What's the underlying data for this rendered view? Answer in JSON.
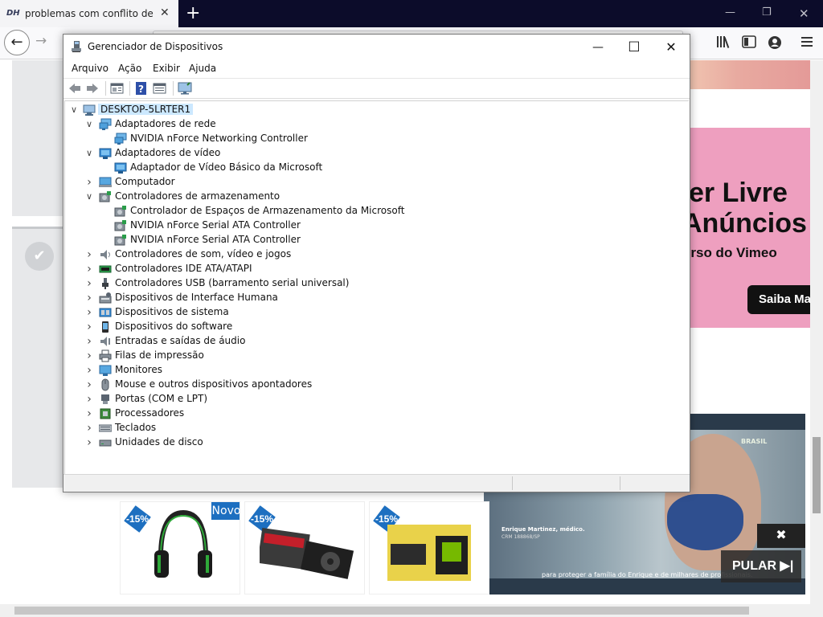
{
  "browser": {
    "tab_title": "problemas com conflito de driv",
    "favicon_text": "DH",
    "newtab_glyph": "+",
    "back_glyph": "←",
    "forward_glyph": "→",
    "tab_close_glyph": "✕",
    "minimize_glyph": "—",
    "restore_glyph": "❐",
    "close_glyph": "✕",
    "icons": [
      "library-icon",
      "sidebar-icon",
      "account-icon",
      "menu-icon"
    ]
  },
  "webpage": {
    "pink_ad": {
      "line1": "er Livre",
      "line2": "Anúncios",
      "line3": "urso do Vimeo",
      "button": "Saiba Ma"
    },
    "video_ad": {
      "name": "Enrique Martinez, médico.",
      "crm": "CRM 188868/SP",
      "caption": "para proteger a família do Enrique e de milhares de profissionais.",
      "skip_label": "PULAR ▶|",
      "close_glyph": "✖",
      "brand": "BRASIL"
    },
    "products": [
      {
        "discount": "-15%",
        "badge": "Novo"
      },
      {
        "discount": "-15%"
      },
      {
        "discount": "-15%"
      }
    ],
    "info_glyph": "ⓘ",
    "check_glyph": "✔"
  },
  "device_manager": {
    "title": "Gerenciador de Dispositivos",
    "min_glyph": "—",
    "max_glyph": "☐",
    "close_glyph": "✕",
    "menu": [
      "Arquivo",
      "Ação",
      "Exibir",
      "Ajuda"
    ],
    "toolbar": [
      "back-icon",
      "forward-icon",
      "properties-icon",
      "help-icon",
      "view-icon",
      "monitor-icon"
    ],
    "root": "DESKTOP-5LRTER1",
    "tree": [
      {
        "label": "Adaptadores de rede",
        "expanded": true,
        "icon": "network",
        "children": [
          "NVIDIA nForce Networking Controller"
        ]
      },
      {
        "label": "Adaptadores de vídeo",
        "expanded": true,
        "icon": "display",
        "children": [
          "Adaptador de Vídeo Básico da Microsoft"
        ]
      },
      {
        "label": "Computador",
        "expanded": false,
        "icon": "computer",
        "children": []
      },
      {
        "label": "Controladores de armazenamento",
        "expanded": true,
        "icon": "storage",
        "children": [
          "Controlador de Espaços de Armazenamento da Microsoft",
          "NVIDIA nForce Serial ATA Controller",
          "NVIDIA nForce Serial ATA Controller"
        ]
      },
      {
        "label": "Controladores de som, vídeo e jogos",
        "expanded": false,
        "icon": "sound",
        "children": []
      },
      {
        "label": "Controladores IDE ATA/ATAPI",
        "expanded": false,
        "icon": "ide",
        "children": []
      },
      {
        "label": "Controladores USB (barramento serial universal)",
        "expanded": false,
        "icon": "usb",
        "children": []
      },
      {
        "label": "Dispositivos de Interface Humana",
        "expanded": false,
        "icon": "hid",
        "children": []
      },
      {
        "label": "Dispositivos de sistema",
        "expanded": false,
        "icon": "system",
        "children": []
      },
      {
        "label": "Dispositivos do software",
        "expanded": false,
        "icon": "software",
        "children": []
      },
      {
        "label": "Entradas e saídas de áudio",
        "expanded": false,
        "icon": "audio",
        "children": []
      },
      {
        "label": "Filas de impressão",
        "expanded": false,
        "icon": "printer",
        "children": []
      },
      {
        "label": "Monitores",
        "expanded": false,
        "icon": "monitor",
        "children": []
      },
      {
        "label": "Mouse e outros dispositivos apontadores",
        "expanded": false,
        "icon": "mouse",
        "children": []
      },
      {
        "label": "Portas (COM e LPT)",
        "expanded": false,
        "icon": "port",
        "children": []
      },
      {
        "label": "Processadores",
        "expanded": false,
        "icon": "cpu",
        "children": []
      },
      {
        "label": "Teclados",
        "expanded": false,
        "icon": "keyboard",
        "children": []
      },
      {
        "label": "Unidades de disco",
        "expanded": false,
        "icon": "disk",
        "children": []
      }
    ]
  }
}
